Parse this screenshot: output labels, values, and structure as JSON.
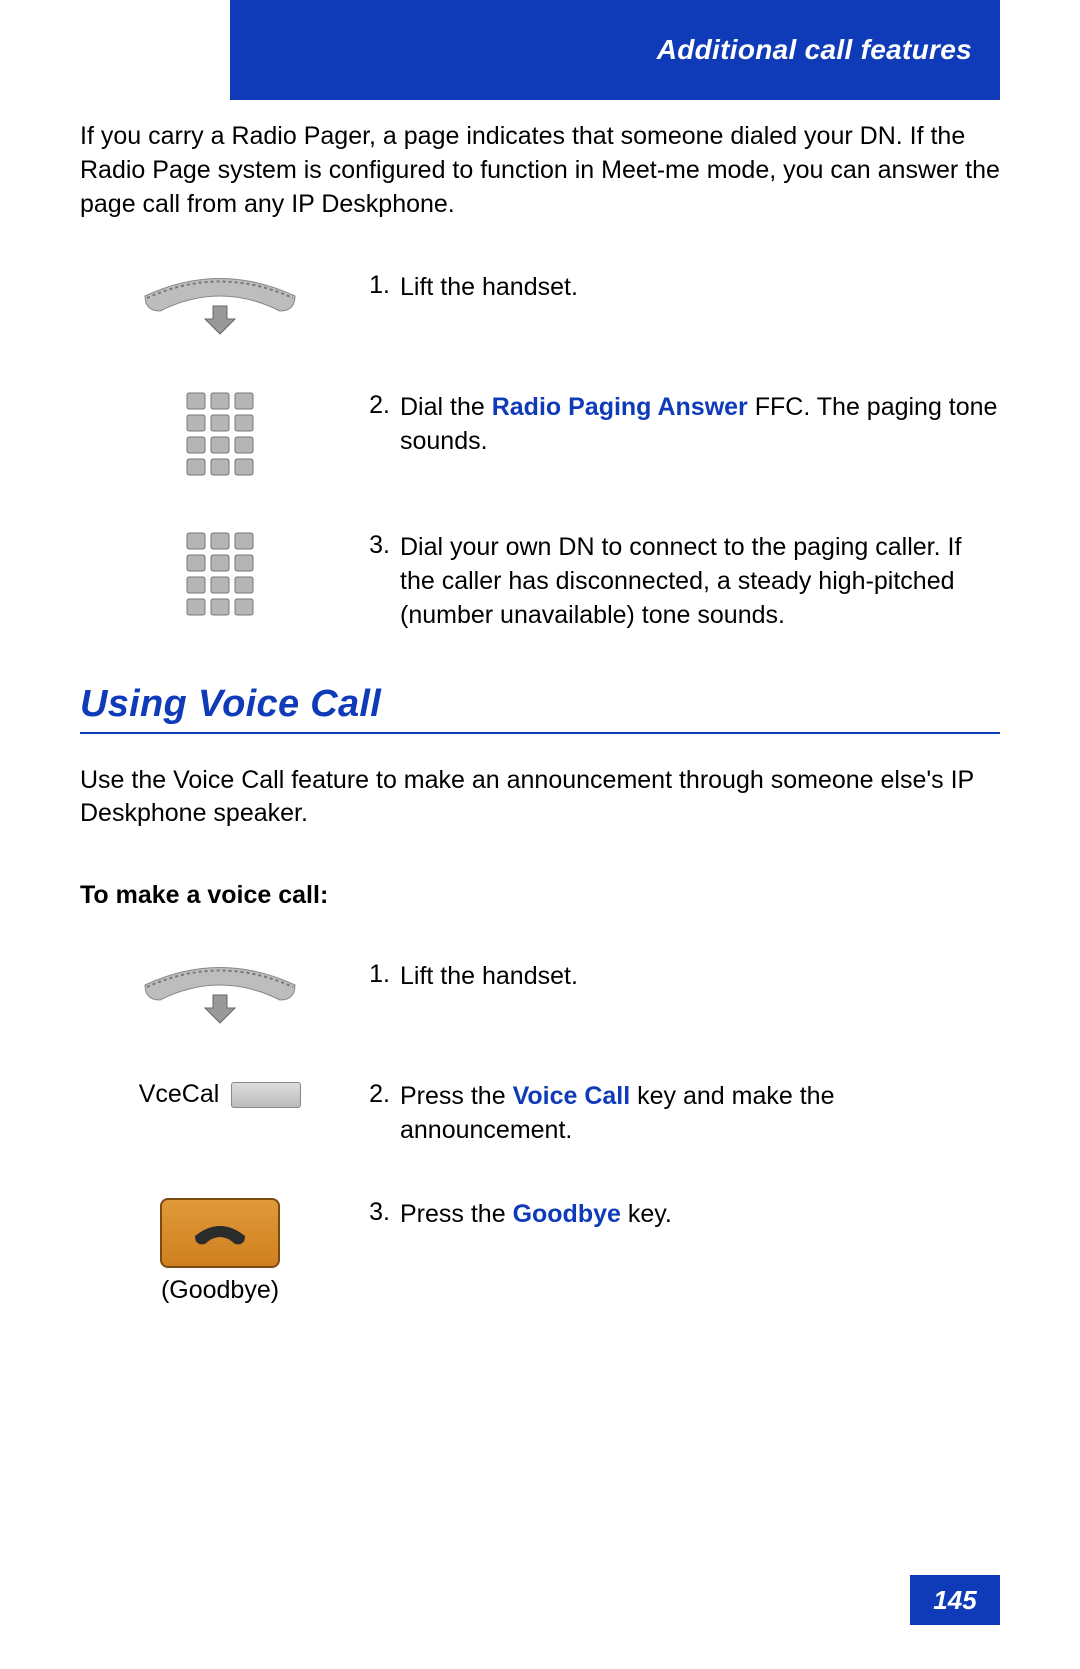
{
  "header": {
    "title": "Additional call features"
  },
  "intro1": "If you carry a Radio Pager, a page indicates that someone dialed your DN. If the Radio Page system is configured to function in Meet-me mode, you can answer the page call from any IP Deskphone.",
  "steps1": [
    {
      "num": "1.",
      "pre": "",
      "hl": "",
      "post": "Lift the handset.",
      "icon": "handset-lift"
    },
    {
      "num": "2.",
      "pre": "Dial the ",
      "hl": "Radio Paging Answer",
      "post": " FFC. The paging tone sounds.",
      "icon": "keypad"
    },
    {
      "num": "3.",
      "pre": "",
      "hl": "",
      "post": "Dial your own DN to connect to the paging caller. If the caller has disconnected, a steady high-pitched (number unavailable) tone sounds.",
      "icon": "keypad"
    }
  ],
  "section2": {
    "title": "Using Voice Call"
  },
  "intro2": "Use the Voice Call feature to make an announcement through someone else's IP Deskphone speaker.",
  "subhead2": "To make a voice call:",
  "steps2": [
    {
      "num": "1.",
      "pre": "",
      "hl": "",
      "post": "Lift the handset.",
      "icon": "handset-lift",
      "caption": ""
    },
    {
      "num": "2.",
      "pre": "Press the ",
      "hl": "Voice Call",
      "post": " key and make the announcement.",
      "icon": "softkey",
      "caption": "VceCal"
    },
    {
      "num": "3.",
      "pre": "Press the ",
      "hl": "Goodbye",
      "post": " key.",
      "icon": "goodbye",
      "caption": "(Goodbye)"
    }
  ],
  "page": "145"
}
